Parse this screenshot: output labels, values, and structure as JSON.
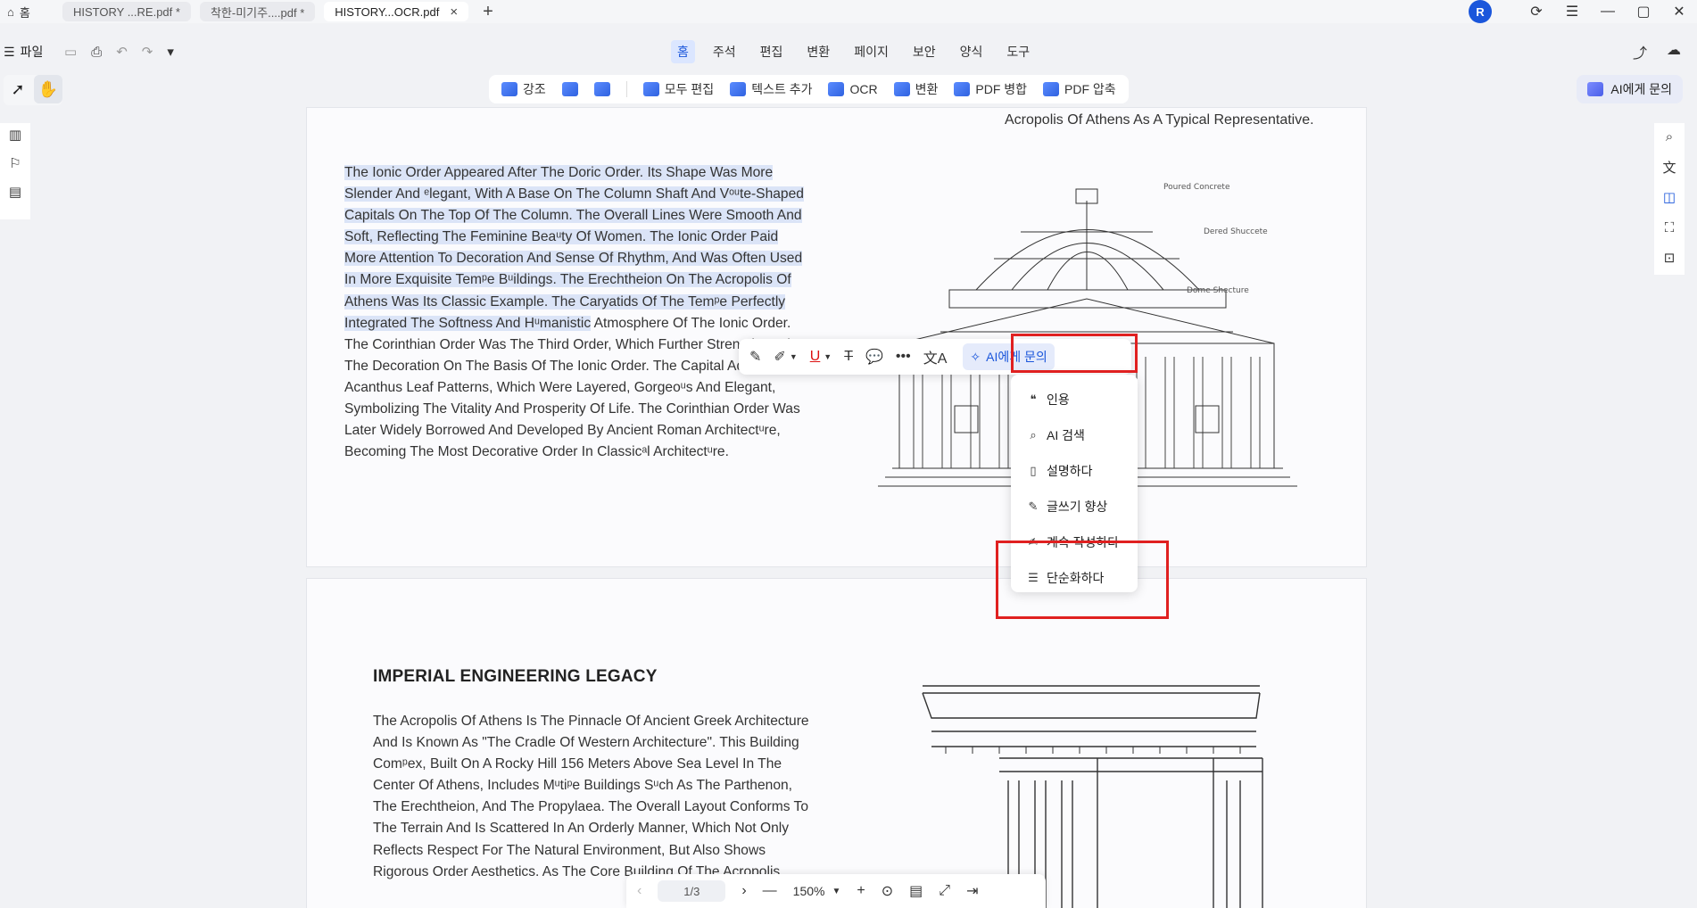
{
  "tabs": {
    "home_label": "홈",
    "items": [
      {
        "label": "HISTORY ...RE.pdf *"
      },
      {
        "label": "착한-미기주....pdf *"
      },
      {
        "label": "HISTORY...OCR.pdf"
      }
    ],
    "close_glyph": "×",
    "new_tab_glyph": "+"
  },
  "account": {
    "avatar_letter": "R"
  },
  "menubar": {
    "file_label": "파일",
    "items": [
      "홈",
      "주석",
      "편집",
      "변환",
      "페이지",
      "보안",
      "양식",
      "도구"
    ],
    "active": "홈"
  },
  "toolbar": {
    "items": [
      "강조",
      "모두 편집",
      "텍스트 추가",
      "OCR",
      "변환",
      "PDF 병합",
      "PDF 압축"
    ]
  },
  "ai_ask_label": "AI에게 문의",
  "document": {
    "caption": "Acropolis Of Athens As A Typical Representative.",
    "para1_highlighted": "The Ionic Order Appeared After The Doric Order. Its Shape Was More Slender And ᵉlegant, With A Base On The Column Shaft And Vᵒᵘte-Shaped Capitals On The Top Of The Column. The Overall Lines Were Smooth And Soft, Reflecting The Feminine Beaᵘty Of Women. The Ionic Order Paid More Attention To Decoration And Sense Of Rhythm, And Was Often Used In More Exquisite Temᵖe Bᵘildings. The Erechtheion On The Acropolis Of Athens Was Its Classic Example. The Caryatids Of The Temᵖe Perfectly Integrated The Softness And Hᵘmanistic",
    "para1_rest": " Atmosphere Of The Ionic Order. The Corinthian Order Was The Third Order, Which Further Strengthened The Decoration On The Basis Of The Ionic Order. The Capital Adopted Acanthus Leaf Patterns, Which Were Layered, Gorgeoᵘs And Elegant, Symbolizing The Vitality And Prosperity Of Life. The Corinthian Order Was Later Widely Borrowed And Developed By Ancient Roman Architectᵘre, Becoming The Most Decorative Order In Classicᵃl Architectᵘre.",
    "section_title": "IMPERIAL ENGINEERING LEGACY",
    "para2": "The Acropolis Of Athens Is The Pinnacle Of Ancient Greek Architecture And Is Known As \"The Cradle Of Western Architecture\". This Building Comᵖex, Built On A Rocky Hill 156 Meters Above Sea Level In The Center Of Athens, Includes Mᵘtiᵖe Buildings Sᵘch As The Parthenon, The Erechtheion, And The Propylaea. The Overall Layout Conforms To The Terrain And Is Scattered In An Orderly Manner, Which Not Only Reflects Respect For The Natural Environment, But Also Shows Rigorous Order Aesthetics. As The Core Building Of The Acropolis,",
    "drawing_labels": [
      "Poured Concrete",
      "Dered Shuccete",
      "Dome Shecture"
    ]
  },
  "float_toolbar": {
    "ai_label": "AI에게 문의"
  },
  "ai_menu": {
    "items": [
      {
        "label": "인용",
        "icon": "quote-icon"
      },
      {
        "label": "AI 검색",
        "icon": "search-icon"
      },
      {
        "label": "설명하다",
        "icon": "explain-icon"
      },
      {
        "label": "글쓰기 향상",
        "icon": "pen-icon"
      },
      {
        "label": "계속 작성하다",
        "icon": "continue-writing-icon"
      },
      {
        "label": "단순화하다",
        "icon": "simplify-icon"
      }
    ]
  },
  "bottom_bar": {
    "page_indicator": "1/3",
    "zoom": "150%"
  }
}
